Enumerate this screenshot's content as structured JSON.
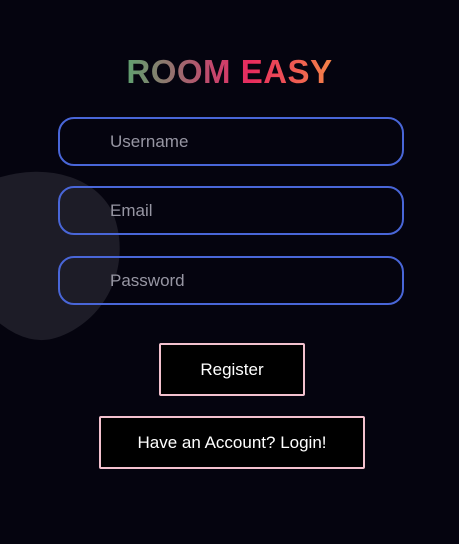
{
  "app": {
    "title": "ROOM EASY"
  },
  "form": {
    "username": {
      "value": "",
      "placeholder": "Username"
    },
    "email": {
      "value": "",
      "placeholder": "Email"
    },
    "password": {
      "value": "",
      "placeholder": "Password"
    },
    "register_label": "Register",
    "login_label": "Have an Account? Login!"
  },
  "colors": {
    "background": "#05040f",
    "input_border": "#4966d8",
    "button_border": "#f3c1ce",
    "title_gradient": [
      "#5fa06f",
      "#c4476d",
      "#e92b5e",
      "#f48448"
    ]
  }
}
